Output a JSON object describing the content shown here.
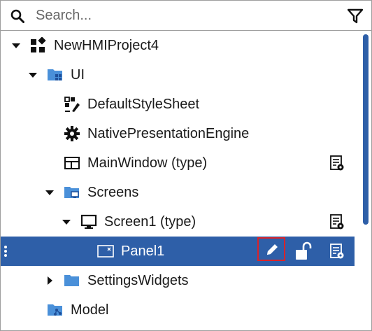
{
  "search": {
    "placeholder": "Search...",
    "value": ""
  },
  "icons": {
    "search": "search-icon",
    "filter": "filter-icon",
    "expanded": "caret-down-icon",
    "collapsed": "caret-right-icon"
  },
  "tree": {
    "items": [
      {
        "label": "NewHMIProject4",
        "icon": "project-icon",
        "expanded": true
      },
      {
        "label": "UI",
        "icon": "ui-folder-icon",
        "expanded": true
      },
      {
        "label": "DefaultStyleSheet",
        "icon": "stylesheet-icon"
      },
      {
        "label": "NativePresentationEngine",
        "icon": "gear-icon"
      },
      {
        "label": "MainWindow (type)",
        "icon": "window-icon",
        "props_icon": "properties-icon"
      },
      {
        "label": "Screens",
        "icon": "screens-folder-icon",
        "expanded": true
      },
      {
        "label": "Screen1 (type)",
        "icon": "monitor-icon",
        "expanded": true,
        "props_icon": "properties-icon"
      },
      {
        "label": "Panel1",
        "icon": "panel-icon",
        "selected": true,
        "actions": [
          "edit-icon",
          "unlock-icon",
          "properties-icon"
        ]
      },
      {
        "label": "SettingsWidgets",
        "icon": "folder-icon",
        "expanded": false
      },
      {
        "label": "Model",
        "icon": "model-folder-icon",
        "expanded": false
      }
    ]
  },
  "colors": {
    "selection": "#2e5fa8",
    "folder": "#4a90d9",
    "highlight_border": "#d9232a",
    "scroll_thumb": "#2e5fa8"
  }
}
